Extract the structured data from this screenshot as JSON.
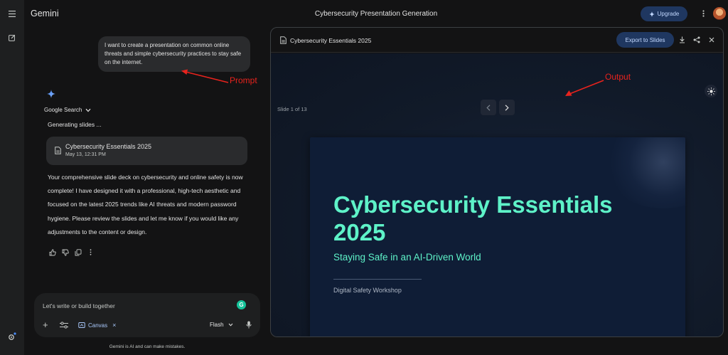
{
  "app": {
    "brand": "Gemini",
    "conversation_title": "Cybersecurity Presentation Generation",
    "upgrade_label": "Upgrade"
  },
  "chat": {
    "user_prompt": "I want to create a presentation on common online threats and simple cybersecurity practices to stay safe on the internet.",
    "tool_label": "Google Search",
    "status_text": "Generating slides ...",
    "doc_card": {
      "title": "Cybersecurity Essentials 2025",
      "timestamp": "May 13, 12:31 PM"
    },
    "response_text": "Your comprehensive slide deck on cybersecurity and online safety is now complete! I have designed it with a professional, high-tech aesthetic and focused on the latest 2025 trends like AI threats and modern password hygiene. Please review the slides and let me know if you would like any adjustments to the content or design."
  },
  "annotations": {
    "prompt_label": "Prompt",
    "output_label": "Output",
    "color": "#e8231d"
  },
  "composer": {
    "placeholder": "Let's write or build together",
    "canvas_label": "Canvas",
    "model_label": "Flash",
    "disclaimer": "Gemini is AI and can make mistakes."
  },
  "canvas_panel": {
    "doc_title": "Cybersecurity Essentials 2025",
    "export_label": "Export to Slides",
    "slide_counter": "Slide 1 of 13",
    "slide": {
      "title": "Cybersecurity Essentials 2025",
      "subtitle": "Staying Safe in an AI-Driven World",
      "footer": "Digital Safety Workshop"
    }
  },
  "icons": {
    "menu": "menu-icon",
    "new_chat": "edit-icon",
    "settings": "settings-icon",
    "sparkle": "gemini-sparkle-icon",
    "doc": "document-icon",
    "download": "download-icon",
    "share": "share-icon",
    "close": "close-icon",
    "theme": "sun-icon",
    "mic": "mic-icon"
  },
  "colors": {
    "background": "#131314",
    "surface": "#1e1f20",
    "accent_button": "#1f3760",
    "slide_title": "#5ef2c8",
    "slide_bg": "#0f1d36"
  }
}
